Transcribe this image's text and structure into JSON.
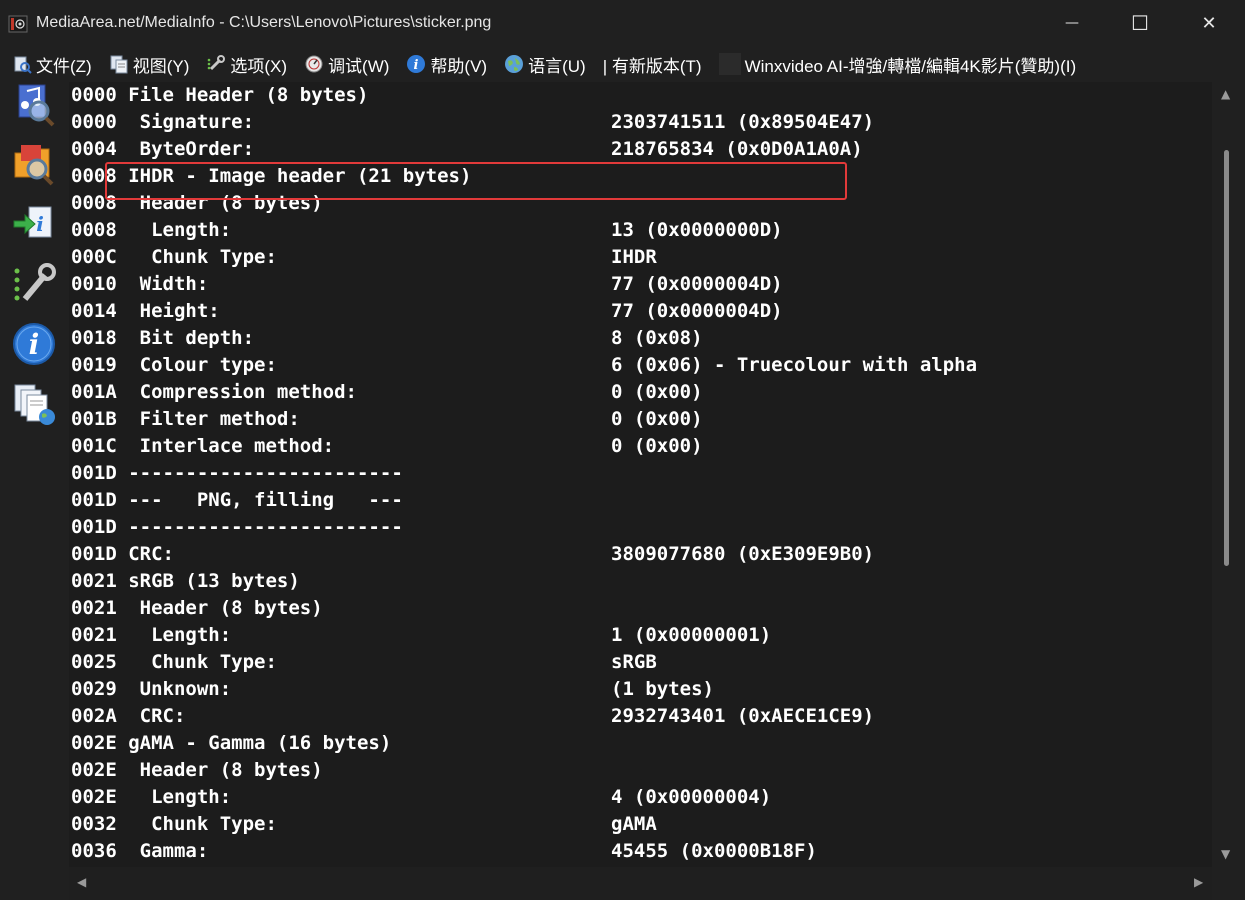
{
  "window": {
    "title": "MediaArea.net/MediaInfo - C:\\Users\\Lenovo\\Pictures\\sticker.png",
    "minimize_glyph": "—",
    "maximize_glyph": "☐",
    "close_glyph": "✕"
  },
  "menu": {
    "file": "文件(Z)",
    "view": "视图(Y)",
    "options": "选项(X)",
    "debug": "调试(W)",
    "help": "帮助(V)",
    "language": "语言(U)",
    "new_version": "| 有新版本(T)",
    "sponsor": "Winxvideo AI-增強/轉檔/編輯4K影片(贊助)(I)"
  },
  "sidebar": {
    "icons": [
      "audio-file-search-icon",
      "folder-search-icon",
      "export-info-icon",
      "preferences-tools-icon",
      "about-info-icon",
      "web-files-icon"
    ]
  },
  "report": {
    "lines": [
      {
        "addr": "0000",
        "label": "File Header (8 bytes)",
        "value": ""
      },
      {
        "addr": "0000",
        "label": " Signature:",
        "value": "2303741511 (0x89504E47)"
      },
      {
        "addr": "0004",
        "label": " ByteOrder:",
        "value": "218765834 (0x0D0A1A0A)"
      },
      {
        "addr": "0008",
        "label": "IHDR - Image header (21 bytes)",
        "value": ""
      },
      {
        "addr": "0008",
        "label": " Header (8 bytes)",
        "value": ""
      },
      {
        "addr": "0008",
        "label": "  Length:",
        "value": "13 (0x0000000D)"
      },
      {
        "addr": "000C",
        "label": "  Chunk Type:",
        "value": "IHDR"
      },
      {
        "addr": "0010",
        "label": " Width:",
        "value": "77 (0x0000004D)"
      },
      {
        "addr": "0014",
        "label": " Height:",
        "value": "77 (0x0000004D)"
      },
      {
        "addr": "0018",
        "label": " Bit depth:",
        "value": "8 (0x08)"
      },
      {
        "addr": "0019",
        "label": " Colour type:",
        "value": "6 (0x06) - Truecolour with alpha"
      },
      {
        "addr": "001A",
        "label": " Compression method:",
        "value": "0 (0x00)"
      },
      {
        "addr": "001B",
        "label": " Filter method:",
        "value": "0 (0x00)"
      },
      {
        "addr": "001C",
        "label": " Interlace method:",
        "value": "0 (0x00)"
      },
      {
        "addr": "001D",
        "label": "------------------------",
        "value": ""
      },
      {
        "addr": "001D",
        "label": "---   PNG, filling   ---",
        "value": ""
      },
      {
        "addr": "001D",
        "label": "------------------------",
        "value": ""
      },
      {
        "addr": "001D",
        "label": "CRC:",
        "value": "3809077680 (0xE309E9B0)"
      },
      {
        "addr": "0021",
        "label": "sRGB (13 bytes)",
        "value": ""
      },
      {
        "addr": "0021",
        "label": " Header (8 bytes)",
        "value": ""
      },
      {
        "addr": "0021",
        "label": "  Length:",
        "value": "1 (0x00000001)"
      },
      {
        "addr": "0025",
        "label": "  Chunk Type:",
        "value": "sRGB"
      },
      {
        "addr": "0029",
        "label": " Unknown:",
        "value": "(1 bytes)"
      },
      {
        "addr": "002A",
        "label": " CRC:",
        "value": "2932743401 (0xAECE1CE9)"
      },
      {
        "addr": "002E",
        "label": "gAMA - Gamma (16 bytes)",
        "value": ""
      },
      {
        "addr": "002E",
        "label": " Header (8 bytes)",
        "value": ""
      },
      {
        "addr": "002E",
        "label": "  Length:",
        "value": "4 (0x00000004)"
      },
      {
        "addr": "0032",
        "label": "  Chunk Type:",
        "value": "gAMA"
      },
      {
        "addr": "0036",
        "label": " Gamma:",
        "value": "45455 (0x0000B18F)"
      }
    ],
    "highlight_color": "#e23a3a"
  }
}
